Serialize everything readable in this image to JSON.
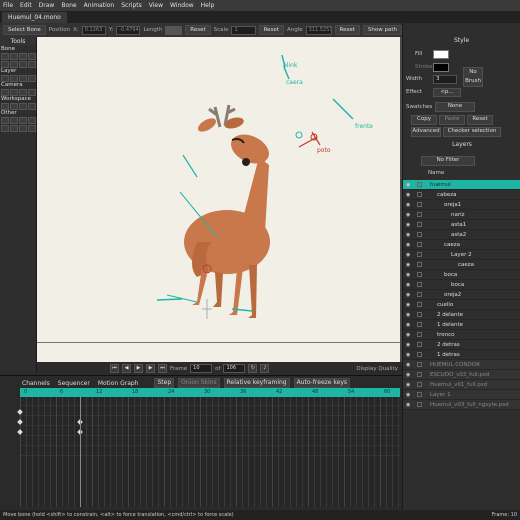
{
  "menu": [
    "File",
    "Edit",
    "Draw",
    "Bone",
    "Animation",
    "Scripts",
    "View",
    "Window",
    "Help"
  ],
  "document_tab": "Huemul_04.mono",
  "tool_options": {
    "select_bone": "Select Bone",
    "position_label": "Position",
    "x_label": "X:",
    "x_value": "0.1263",
    "y_label": "Y:",
    "y_value": "-0.4794",
    "length_label": "Length",
    "reset1": "Reset",
    "scale_label": "Scale",
    "scale_value": "1",
    "reset2": "Reset",
    "angle_label": "Angle",
    "angle_value": "311.5257",
    "reset3": "Reset",
    "show_path": "Show path"
  },
  "tools_panel": {
    "title": "Tools",
    "sections": [
      "Bone",
      "Layer",
      "Camera",
      "Workspace",
      "Other"
    ]
  },
  "canvas": {
    "bone_labels": [
      "blink",
      "caera",
      "frente",
      "poto"
    ]
  },
  "playback": {
    "frame_label": "Frame",
    "frame_value": "10",
    "of_label": "of",
    "total_frames": "106",
    "display_quality": "Display Quality"
  },
  "timeline": {
    "tabs": [
      "Channels",
      "Sequencer",
      "Motion Graph"
    ],
    "step": "Step",
    "onion_skins": "Onion Skins",
    "relative_keyframing": "Relative keyframing",
    "auto_freeze": "Auto-freeze keys",
    "ruler": [
      "0",
      "6",
      "12",
      "18",
      "24",
      "30",
      "36",
      "42",
      "48",
      "54",
      "60"
    ]
  },
  "style_panel": {
    "title": "Style",
    "fill_label": "Fill",
    "stroke_label": "Stroke",
    "width_label": "Width",
    "width_value": "3",
    "no_brush": "No Brush",
    "effect_label": "Effect",
    "effect_value": "<p...",
    "swatches_label": "Swatches",
    "swatches_value": "None",
    "copy": "Copy",
    "paste": "Paste",
    "reset": "Reset",
    "advanced": "Advanced",
    "checker_selection": "Checker selection"
  },
  "layers_panel": {
    "title": "Layers",
    "filter": "No Filter",
    "name_header": "Name",
    "layers": [
      "huemul",
      "cabeza",
      "oreja1",
      "nariz",
      "asta1",
      "asta2",
      "caeza",
      "Layer 2",
      "caeza",
      "boca",
      "boca",
      "oreja2",
      "cuello",
      "2 delante",
      "1 delante",
      "tronco",
      "2 detras",
      "1 detras",
      "HUEMUL CONDOR",
      "ESCUDO_v03_full.psd",
      "Huemul_v01_full.psd",
      "Layer 1",
      "Huemul_v03_full_ngsyte.psd"
    ]
  },
  "status": {
    "hint": "Move bone (hold <shift> to constrain, <alt> to force translation, <cmd/ctrl> to force scale)",
    "frame": "Frame: 10"
  },
  "colors": {
    "accent_teal": "#1fb5a5",
    "canvas_bg": "#f2f0e6",
    "deer_body": "#c8784a",
    "bone_red": "#c0392b"
  }
}
